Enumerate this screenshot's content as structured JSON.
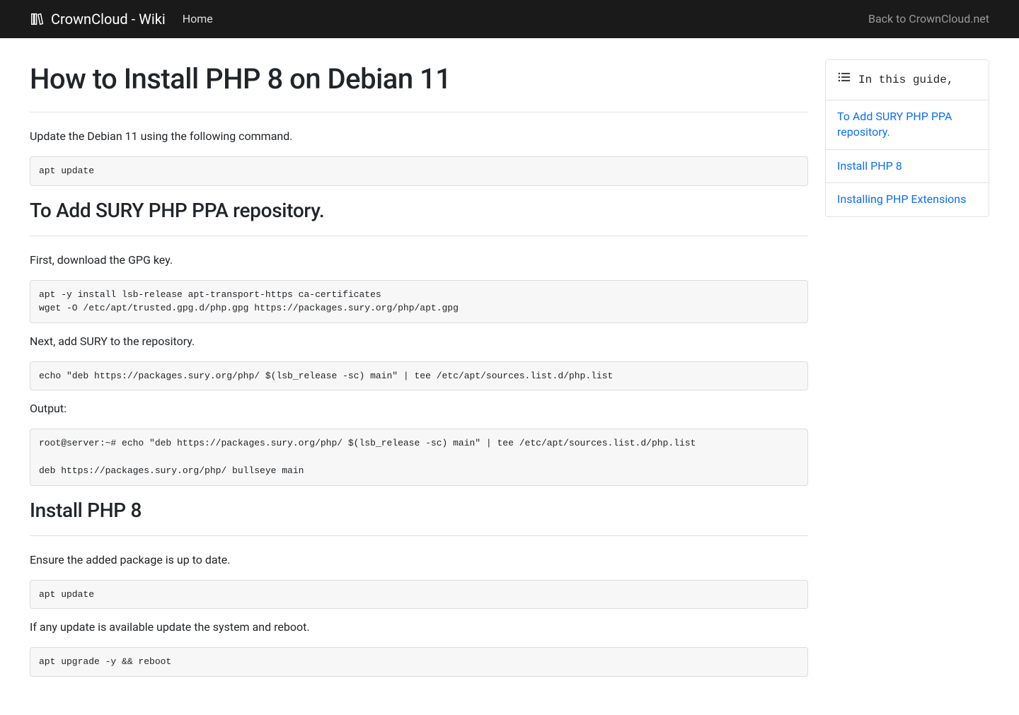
{
  "navbar": {
    "brand": "CrownCloud - Wiki",
    "home": "Home",
    "back": "Back to CrownCloud.net"
  },
  "page": {
    "title": "How to Install PHP 8 on Debian 11",
    "p_intro": "Update the Debian 11 using the following command.",
    "code_update1": "apt update",
    "h2_sury": "To Add SURY PHP PPA repository.",
    "p_gpg": "First, download the GPG key.",
    "code_gpg": "apt -y install lsb-release apt-transport-https ca-certificates\nwget -O /etc/apt/trusted.gpg.d/php.gpg https://packages.sury.org/php/apt.gpg",
    "p_addrepo": "Next, add SURY to the repository.",
    "code_addrepo": "echo \"deb https://packages.sury.org/php/ $(lsb_release -sc) main\" | tee /etc/apt/sources.list.d/php.list",
    "p_output": "Output:",
    "code_output": "root@server:~# echo \"deb https://packages.sury.org/php/ $(lsb_release -sc) main\" | tee /etc/apt/sources.list.d/php.list\n\ndeb https://packages.sury.org/php/ bullseye main",
    "h2_install": "Install PHP 8",
    "p_ensure": "Ensure the added package is up to date.",
    "code_update2": "apt update",
    "p_ifupdate": "If any update is available update the system and reboot.",
    "code_upgrade": "apt upgrade -y && reboot"
  },
  "toc": {
    "header": "In this guide,",
    "items": [
      "To Add SURY PHP PPA repository.",
      "Install PHP 8",
      "Installing PHP Extensions"
    ]
  }
}
